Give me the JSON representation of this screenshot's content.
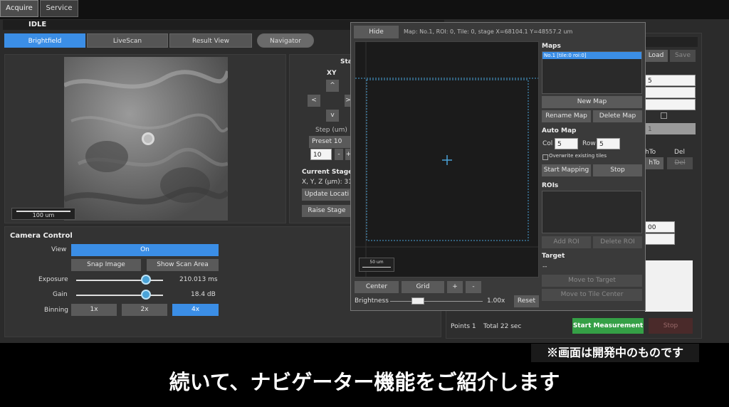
{
  "topTabs": [
    "Acquire",
    "Service"
  ],
  "statusText": "IDLE",
  "viewTabs": [
    "Brightfield",
    "LiveScan",
    "Result View",
    "Navigator"
  ],
  "image": {
    "scaleLabel": "100 um"
  },
  "stage": {
    "titlePartial": "Sta",
    "xyLabel": "XY",
    "arrows": {
      "up": "^",
      "left": "<",
      "right": ">",
      "down": "v"
    },
    "stepLabel": "Step (um)",
    "presetValue": "Preset 10",
    "stepValue": "10",
    "stepMinus": "-",
    "stepPlus": "+",
    "currentTitle": "Current Stage I",
    "xyzText": "X, Y, Z (µm): 31",
    "updateBtn": "Update Locati",
    "raiseBtn": "Raise Stage"
  },
  "camera": {
    "title": "Camera Control",
    "viewLabel": "View",
    "viewValue": "On",
    "snapBtn": "Snap Image",
    "scanAreaBtn": "Show Scan Area",
    "exposureLabel": "Exposure",
    "exposureValue": "210.013 ms",
    "exposureLevel": 0.8,
    "gainLabel": "Gain",
    "gainValue": "18.4 dB",
    "gainLevel": 0.8,
    "binningLabel": "Binning",
    "binning": [
      "1x",
      "2x",
      "4x"
    ],
    "binningSelected": "4x"
  },
  "navigator": {
    "hideBtn": "Hide",
    "infoText": "Map: No.1, ROI: 0, Tile: 0, stage X=68104.1 Y=48557.2 um",
    "miniScale": "50 um",
    "centerBtn": "Center",
    "gridBtn": "Grid",
    "plusBtn": "+",
    "minusBtn": "-",
    "brightnessLabel": "Brightness",
    "brightnessValue": "1.00x",
    "resetBtn": "Reset",
    "mapsTitle": "Maps",
    "mapsSelected": "No.1 [tile:0 roi:0]",
    "newMapBtn": "New Map",
    "renameMapBtn": "Rename Map",
    "deleteMapBtn": "Delete Map",
    "autoMapTitle": "Auto Map",
    "colLabel": "Col",
    "colValue": "5",
    "rowLabel": "Row",
    "rowValue": "5",
    "overwriteLabel": "Overwrite existing tiles",
    "startMappingBtn": "Start Mapping",
    "stopBtn": "Stop",
    "roisTitle": "ROIs",
    "addRoiBtn": "Add ROI",
    "deleteRoiBtn": "Delete ROI",
    "targetTitle": "Target",
    "targetValue": "--",
    "moveTargetBtn": "Move to Target",
    "moveTileBtn": "Move to Tile Center"
  },
  "rightPanel": {
    "loadBtn": "Load",
    "saveBtn": "Save",
    "field1": "5",
    "field5": "1",
    "toLabel": "hTo",
    "delLabel": "Del",
    "toBtn": "hTo",
    "delBtn": "Del",
    "field6": "00",
    "pointsLabel": "Points 1",
    "totalLabel": "Total  22 sec",
    "startMeasurementBtn": "Start Measurement",
    "stopBtn": "Stop"
  },
  "overlay": {
    "note": "※画面は開発中のものです",
    "subtitle": "続いて、ナビゲーター機能をご紹介します"
  }
}
